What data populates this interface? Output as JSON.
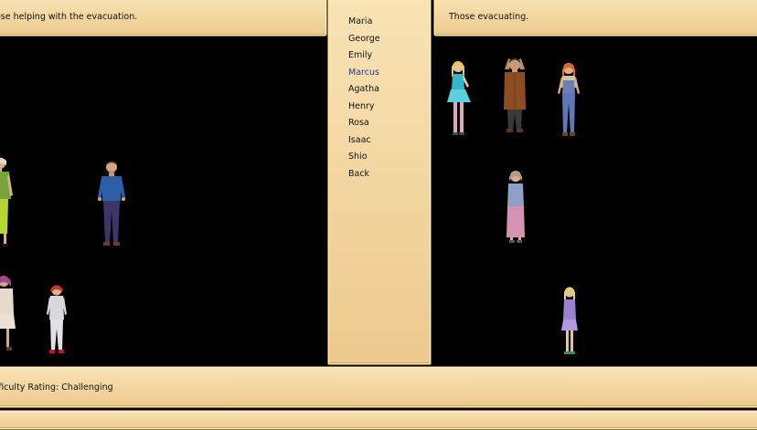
{
  "left_panel": {
    "heading": "ose helping with the evacuation."
  },
  "right_panel": {
    "heading": "Those evacuating."
  },
  "menu": {
    "items": [
      "Maria",
      "George",
      "Emily",
      "Marcus",
      "Agatha",
      "Henry",
      "Rosa",
      "Isaac",
      "Shio",
      "Back"
    ],
    "selected_index": 3
  },
  "status": {
    "difficulty_text": "fficulty Rating: Challenging"
  },
  "colors": {
    "panel": "#f3d8a3",
    "panel_border": "#8d6d35",
    "selected_item": "#27398f",
    "stage": "#000000"
  }
}
